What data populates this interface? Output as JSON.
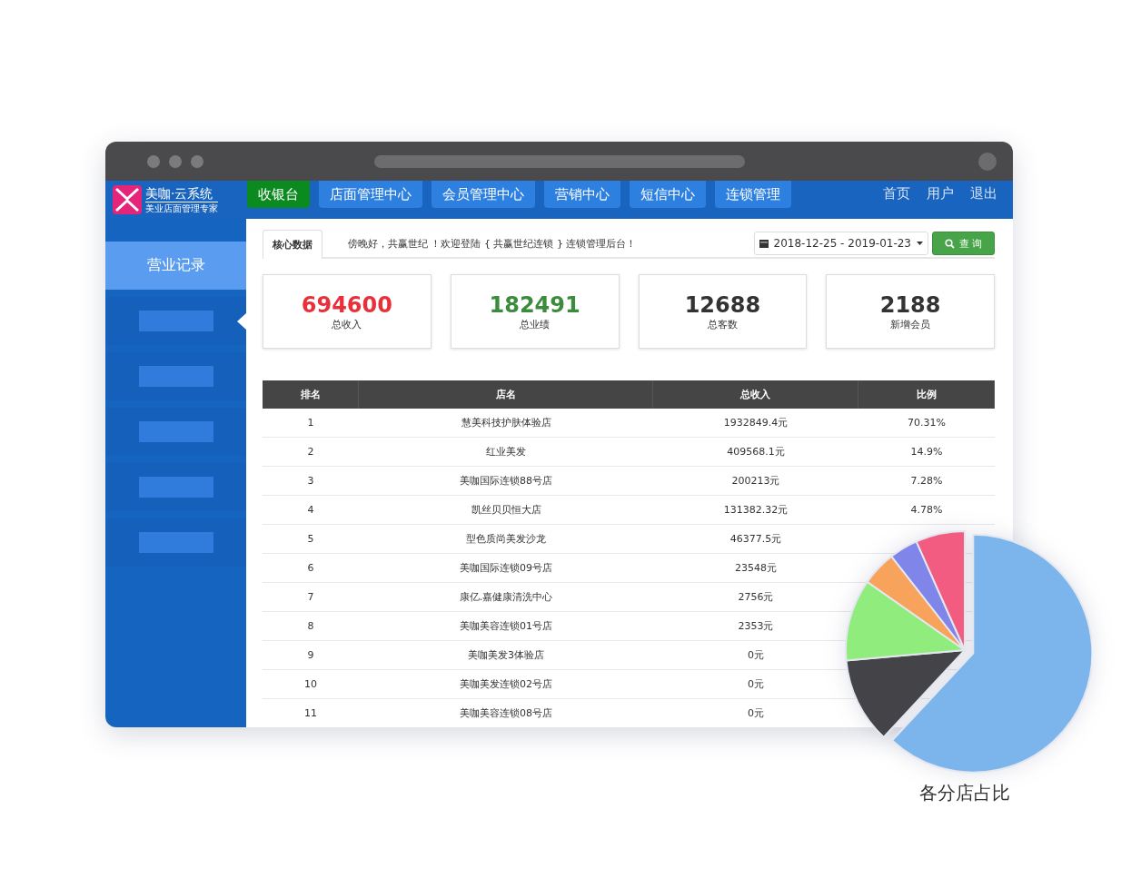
{
  "window": {
    "logo": {
      "title": "美咖·云系统",
      "subtitle": "美业店面管理专家"
    },
    "nav_tabs": [
      {
        "label": "收银台",
        "selected": true
      },
      {
        "label": "店面管理中心",
        "selected": false
      },
      {
        "label": "会员管理中心",
        "selected": false
      },
      {
        "label": "营销中心",
        "selected": false
      },
      {
        "label": "短信中心",
        "selected": false
      },
      {
        "label": "连锁管理",
        "selected": false
      }
    ],
    "header_links": [
      "首页",
      "用户",
      "退出"
    ],
    "sidebar": {
      "items": [
        {
          "label": "营业记录",
          "selected": true,
          "current": false
        },
        {
          "selected": false,
          "current": true
        },
        {
          "selected": false,
          "current": false
        },
        {
          "selected": false,
          "current": false
        },
        {
          "selected": false,
          "current": false
        },
        {
          "selected": false,
          "current": false
        }
      ]
    },
    "content_tabs": [
      {
        "label": "核心数据",
        "selected": true
      }
    ],
    "welcome": "傍晚好，共赢世纪 ！欢迎登陆 { 共赢世纪连锁 } 连锁管理后台！",
    "date_range": {
      "value": "2018-12-25 - 2019-01-23"
    },
    "query_button": "查 询",
    "stats": [
      {
        "value": "694600",
        "label": "总收入",
        "color": "#e8303a"
      },
      {
        "value": "182491",
        "label": "总业绩",
        "color": "#3d8b3d"
      },
      {
        "value": "12688",
        "label": "总客数",
        "color": "#333333"
      },
      {
        "value": "2188",
        "label": "新增会员",
        "color": "#333333"
      }
    ],
    "table": {
      "columns": [
        "排名",
        "店名",
        "总收入",
        "比例"
      ],
      "rows": [
        {
          "rank": "1",
          "store": "慧美科技护肤体验店",
          "income": "1932849.4元",
          "ratio": "70.31%"
        },
        {
          "rank": "2",
          "store": "红业美发",
          "income": "409568.1元",
          "ratio": "14.9%"
        },
        {
          "rank": "3",
          "store": "美咖国际连锁88号店",
          "income": "200213元",
          "ratio": "7.28%"
        },
        {
          "rank": "4",
          "store": "凯丝贝贝恒大店",
          "income": "131382.32元",
          "ratio": "4.78%"
        },
        {
          "rank": "5",
          "store": "型色质尚美发沙龙",
          "income": "46377.5元"
        },
        {
          "rank": "6",
          "store": "美咖国际连锁09号店",
          "income": "23548元"
        },
        {
          "rank": "7",
          "store": "康亿.嘉健康清洗中心",
          "income": "2756元"
        },
        {
          "rank": "8",
          "store": "美咖美容连锁01号店",
          "income": "2353元"
        },
        {
          "rank": "9",
          "store": "美咖美发3体验店",
          "income": "0元"
        },
        {
          "rank": "10",
          "store": "美咖美发连锁02号店",
          "income": "0元"
        },
        {
          "rank": "11",
          "store": "美咖美容连锁08号店",
          "income": "0元"
        }
      ]
    }
  },
  "pie_chart": {
    "title": "各分店占比"
  }
}
